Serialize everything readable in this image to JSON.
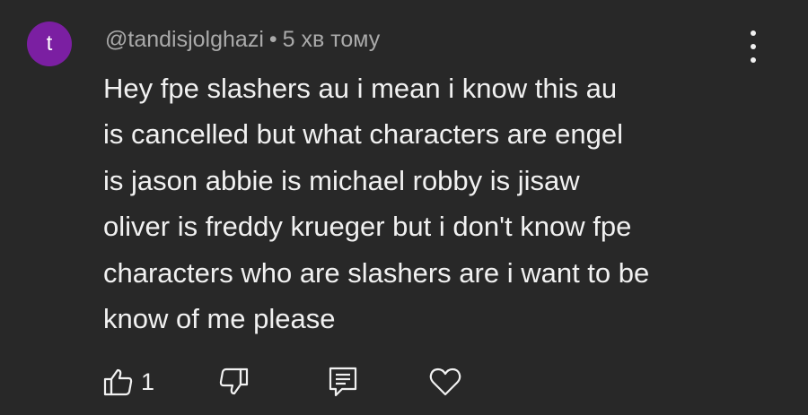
{
  "comment": {
    "avatar_letter": "t",
    "avatar_color": "#7b1fa2",
    "author": "@tandisjolghazi",
    "separator": "•",
    "time": "5 хв тому",
    "lines": [
      "Hey fpe slashers au i mean i know this au",
      "is cancelled but what characters are engel",
      "is jason abbie is michael robby is jisaw",
      "oliver is freddy krueger but i don't know fpe",
      "characters who are slashers are i want to be",
      "know of me please"
    ],
    "like_count": "1"
  },
  "icons": {
    "more": "more-vertical-icon",
    "like": "thumbs-up-icon",
    "dislike": "thumbs-down-icon",
    "reply": "reply-icon",
    "heart": "heart-icon"
  },
  "colors": {
    "background": "#282828",
    "text": "#f1f1f1",
    "secondary_text": "#aaaaaa"
  }
}
